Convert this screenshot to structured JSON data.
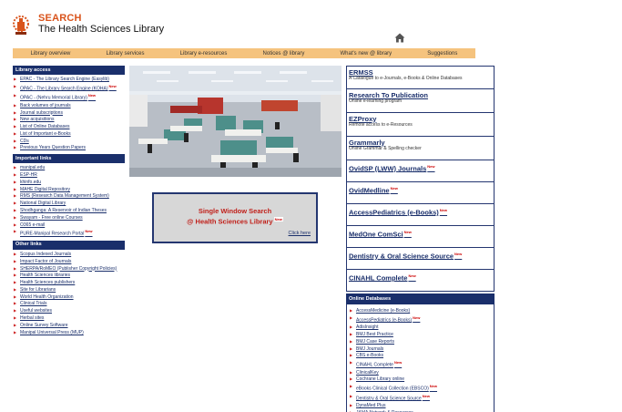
{
  "header": {
    "brand_word": "SEARCH",
    "title": "The Health Sciences Library"
  },
  "nav": [
    "Library overview",
    "Library services",
    "Library e-resources",
    "Notices @ library",
    "What's new @ library",
    "Suggestions"
  ],
  "library_access": {
    "heading": "Library access",
    "items": [
      {
        "label": "EPAC - The Library Search Engine (Easylib)",
        "new": ""
      },
      {
        "label": "OPAC - The Library Search Engine (KOHA)",
        "new": "New"
      },
      {
        "label": "OPAC - (Nehru Memorial Library)",
        "new": "New"
      },
      {
        "label": "Back volumes of journals",
        "new": ""
      },
      {
        "label": "Journal subscriptions",
        "new": ""
      },
      {
        "label": "New acquisitions",
        "new": ""
      },
      {
        "label": "List of Online Databases",
        "new": ""
      },
      {
        "label": "List of Important e-Books",
        "new": ""
      },
      {
        "label": "CDs",
        "new": ""
      },
      {
        "label": "Previous Years Question Papers",
        "new": ""
      }
    ]
  },
  "important_links": {
    "heading": "Important links",
    "items": [
      {
        "label": "manipal.edu",
        "new": ""
      },
      {
        "label": "ESP-HR",
        "new": ""
      },
      {
        "label": "khinfo.edu",
        "new": ""
      },
      {
        "label": "MAHE Digital Repository",
        "new": ""
      },
      {
        "label": "RMS (Research Data Management System)",
        "new": ""
      },
      {
        "label": "National Digital Library",
        "new": ""
      },
      {
        "label": "Shodhganga: A Reservoir of Indian Theses",
        "new": ""
      },
      {
        "label": "Swayam - Free online Courses",
        "new": ""
      },
      {
        "label": "O365 e-mail",
        "new": ""
      },
      {
        "label": "PURE-Manipal Research Portal",
        "new": "New"
      }
    ]
  },
  "other_links": {
    "heading": "Other links",
    "items": [
      {
        "label": "Scopus Indexed Journals",
        "new": ""
      },
      {
        "label": "Impact Factor of Journals",
        "new": ""
      },
      {
        "label": "SHERPA/RoMEO (Publisher Copyright Policies)",
        "new": ""
      },
      {
        "label": "Health Sciences libraries",
        "new": ""
      },
      {
        "label": "Health Sciences publishers",
        "new": ""
      },
      {
        "label": "Site for Librarians",
        "new": ""
      },
      {
        "label": "World Health Organization",
        "new": ""
      },
      {
        "label": "Clinical Trials",
        "new": ""
      },
      {
        "label": "Useful websites",
        "new": ""
      },
      {
        "label": "Herbal sites",
        "new": ""
      },
      {
        "label": "Online Survey Software",
        "new": ""
      },
      {
        "label": "Manipal Universal Press (MUP)",
        "new": ""
      }
    ]
  },
  "single_window": {
    "line1": "Single Window Search",
    "line2": "@ Health Sciences Library",
    "new": "New",
    "click": "Click here"
  },
  "resources": [
    {
      "title": "ERMSS",
      "desc": "A Catalogue to e-Journals, e-Books & Online Databases",
      "new": ""
    },
    {
      "title": "Research To Publication",
      "desc": "Online e-learning program",
      "new": ""
    },
    {
      "title": "EZProxy",
      "desc": "Remote access to e-Resources",
      "new": ""
    },
    {
      "title": "Grammarly",
      "desc": "Online Grammar & Spelling checker",
      "new": ""
    },
    {
      "title": "OvidSP (LWW) Journals",
      "desc": "",
      "new": "New"
    },
    {
      "title": "OvidMedline",
      "desc": "",
      "new": "New"
    },
    {
      "title": "AccessPediatrics (e-Books)",
      "desc": "",
      "new": "New"
    },
    {
      "title": "MedOne ComSci",
      "desc": "",
      "new": "New"
    },
    {
      "title": "Dentistry & Oral Science Source",
      "desc": "",
      "new": "New"
    },
    {
      "title": "CINAHL Complete",
      "desc": "",
      "new": "New"
    }
  ],
  "online_databases": {
    "heading": "Online Databases",
    "items": [
      {
        "label": "AccessMedicine (e-Books)",
        "new": ""
      },
      {
        "label": "AccessPediatrics (e-Books)",
        "new": "New"
      },
      {
        "label": "AdisInsight",
        "new": ""
      },
      {
        "label": "BMJ Best Practice",
        "new": ""
      },
      {
        "label": "BMJ Case Reports",
        "new": ""
      },
      {
        "label": "BMJ Journals",
        "new": ""
      },
      {
        "label": "CBS e-Books",
        "new": ""
      },
      {
        "label": "CINAHL Complete",
        "new": "New"
      },
      {
        "label": "ClinicalKey",
        "new": ""
      },
      {
        "label": "Cochrane Library online",
        "new": ""
      },
      {
        "label": "eBooks Clinical Collection (EBSCO)",
        "new": "New"
      },
      {
        "label": "Dentistry & Oral Science Source",
        "new": "New"
      },
      {
        "label": "DynaMed Plus",
        "new": ""
      },
      {
        "label": "JAMA Network & Resources",
        "new": ""
      }
    ]
  },
  "colors": {
    "nav_bg": "#f5c37e",
    "heading_bg": "#1a2f6b",
    "brand": "#d9541c",
    "new_badge": "#cc0000"
  }
}
